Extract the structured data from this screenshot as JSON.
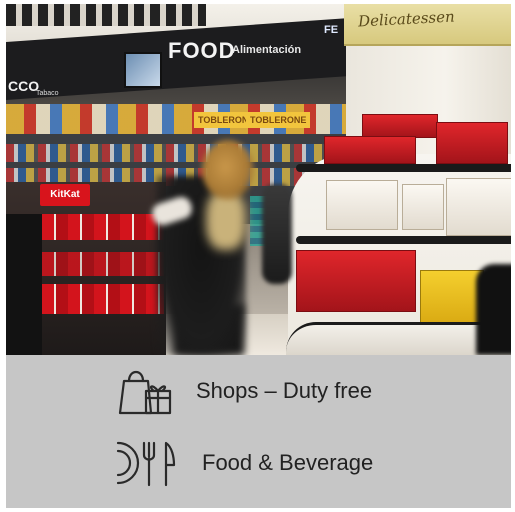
{
  "photo": {
    "signs": {
      "food": "FOOD",
      "food_sub": "Alimentación",
      "left_sign": "CCO",
      "left_sub": "Tabaco",
      "top_right_partial": "FE",
      "delicatessen": "Delicatessen",
      "toblerone_1": "TOBLERONE",
      "toblerone_2": "TOBLERONE",
      "kitkat": "KitKat"
    }
  },
  "legend": {
    "items": [
      {
        "icon": "shopping-bags-icon",
        "label": "Shops – Duty free"
      },
      {
        "icon": "cutlery-icon",
        "label": "Food & Beverage"
      }
    ]
  },
  "colors": {
    "panel_background": "#c6c6c6",
    "text": "#222222",
    "icon_stroke": "#2a2a2a"
  }
}
